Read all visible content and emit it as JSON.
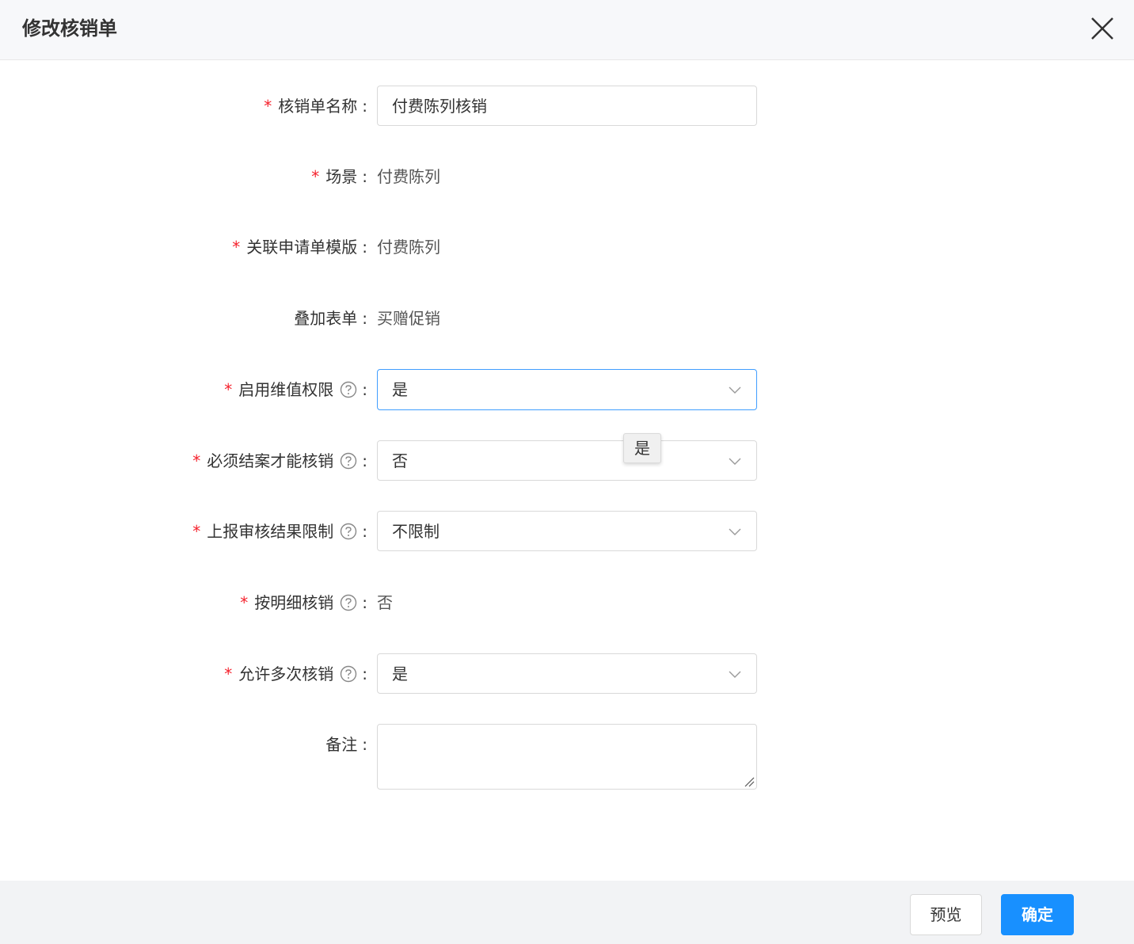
{
  "dialog": {
    "title": "修改核销单"
  },
  "form": {
    "name": {
      "label": "核销单名称",
      "value": "付费陈列核销"
    },
    "scene": {
      "label": "场景",
      "value": "付费陈列"
    },
    "template": {
      "label": "关联申请单模版",
      "value": "付费陈列"
    },
    "overlay": {
      "label": "叠加表单",
      "value": "买赠促销"
    },
    "permission": {
      "label": "启用维值权限",
      "value": "是"
    },
    "must_close": {
      "label": "必须结案才能核销",
      "value": "否"
    },
    "report_limit": {
      "label": "上报审核结果限制",
      "value": "不限制"
    },
    "by_detail": {
      "label": "按明细核销",
      "value": "否"
    },
    "multiple": {
      "label": "允许多次核销",
      "value": "是"
    },
    "remark": {
      "label": "备注",
      "value": ""
    },
    "required_mark": "*",
    "colon": ":"
  },
  "tooltip": {
    "text": "是"
  },
  "footer": {
    "preview_label": "预览",
    "confirm_label": "确定"
  },
  "colors": {
    "primary": "#1890ff",
    "required": "#f5222d",
    "focus_border": "#409eff"
  },
  "icons": {
    "close": "close-icon",
    "help": "question-circle-icon",
    "chevron": "chevron-down-icon"
  }
}
